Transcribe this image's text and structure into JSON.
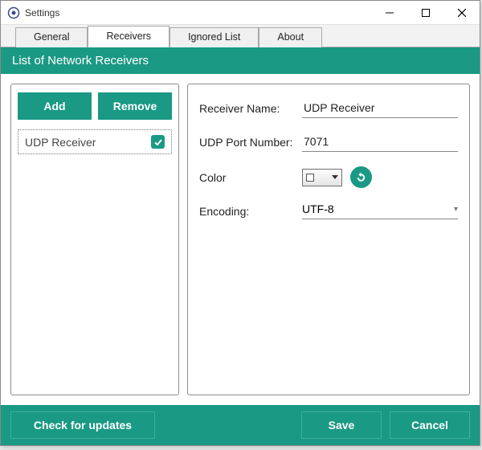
{
  "window": {
    "title": "Settings"
  },
  "tabs": {
    "general": "General",
    "receivers": "Receivers",
    "ignored": "Ignored List",
    "about": "About",
    "active": "receivers"
  },
  "header": {
    "title": "List of Network Receivers"
  },
  "left": {
    "add_label": "Add",
    "remove_label": "Remove",
    "items": [
      {
        "name": "UDP Receiver",
        "checked": true
      }
    ]
  },
  "form": {
    "receiver_name_label": "Receiver Name:",
    "receiver_name_value": "UDP Receiver",
    "port_label": "UDP Port Number:",
    "port_value": "7071",
    "color_label": "Color",
    "encoding_label": "Encoding:",
    "encoding_value": "UTF-8"
  },
  "footer": {
    "check_updates": "Check for updates",
    "save": "Save",
    "cancel": "Cancel"
  }
}
